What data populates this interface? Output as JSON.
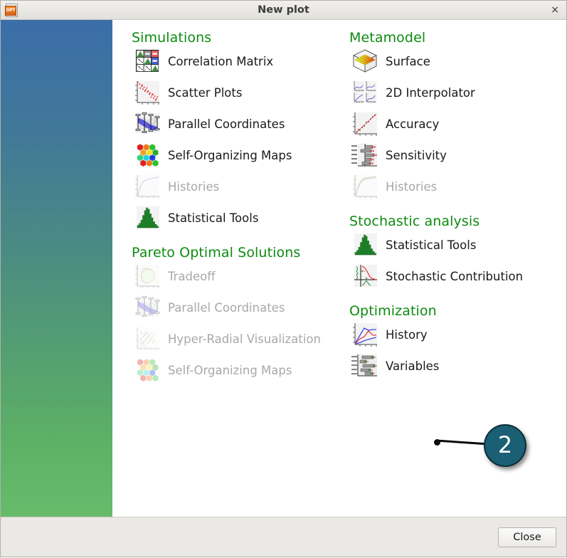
{
  "window": {
    "title": "New plot",
    "app_icon": "opt-document-icon",
    "app_icon_badge": "OPT",
    "close_icon": "×"
  },
  "footer": {
    "close_label": "Close"
  },
  "callout": {
    "number": "2",
    "color": "#1a5f73"
  },
  "colors": {
    "group_title": "#0d8b10",
    "label": "#1a1a1a",
    "label_disabled": "#a8a8a8",
    "panel_gradient_top": "#3b6ea8",
    "panel_gradient_bottom": "#68bb6b"
  },
  "columns": [
    {
      "name": "left-column",
      "groups": [
        {
          "title": "Simulations",
          "items": [
            {
              "label": "Correlation Matrix",
              "icon": "correlation-matrix-icon",
              "enabled": true
            },
            {
              "label": "Scatter Plots",
              "icon": "scatter-plots-icon",
              "enabled": true
            },
            {
              "label": "Parallel Coordinates",
              "icon": "parallel-coordinates-icon",
              "enabled": true
            },
            {
              "label": "Self-Organizing Maps",
              "icon": "self-organizing-maps-icon",
              "enabled": true
            },
            {
              "label": "Histories",
              "icon": "histories-icon",
              "enabled": false
            },
            {
              "label": "Statistical Tools",
              "icon": "statistical-tools-icon",
              "enabled": true
            }
          ]
        },
        {
          "title": "Pareto Optimal Solutions",
          "items": [
            {
              "label": "Tradeoff",
              "icon": "tradeoff-icon",
              "enabled": false
            },
            {
              "label": "Parallel Coordinates",
              "icon": "parallel-coordinates-icon",
              "enabled": false
            },
            {
              "label": "Hyper-Radial Visualization",
              "icon": "hyper-radial-icon",
              "enabled": false
            },
            {
              "label": "Self-Organizing Maps",
              "icon": "self-organizing-maps-icon",
              "enabled": false
            }
          ]
        }
      ]
    },
    {
      "name": "right-column",
      "groups": [
        {
          "title": "Metamodel",
          "items": [
            {
              "label": "Surface",
              "icon": "surface-icon",
              "enabled": true
            },
            {
              "label": "2D Interpolator",
              "icon": "interpolator-2d-icon",
              "enabled": true
            },
            {
              "label": "Accuracy",
              "icon": "accuracy-icon",
              "enabled": true
            },
            {
              "label": "Sensitivity",
              "icon": "sensitivity-icon",
              "enabled": true
            },
            {
              "label": "Histories",
              "icon": "histories-multi-icon",
              "enabled": false
            }
          ]
        },
        {
          "title": "Stochastic analysis",
          "items": [
            {
              "label": "Statistical Tools",
              "icon": "statistical-tools-icon",
              "enabled": true
            },
            {
              "label": "Stochastic Contribution",
              "icon": "stochastic-contribution-icon",
              "enabled": true
            }
          ]
        },
        {
          "title": "Optimization",
          "items": [
            {
              "label": "History",
              "icon": "history-icon",
              "enabled": true
            },
            {
              "label": "Variables",
              "icon": "variables-icon",
              "enabled": true
            }
          ]
        }
      ]
    }
  ]
}
